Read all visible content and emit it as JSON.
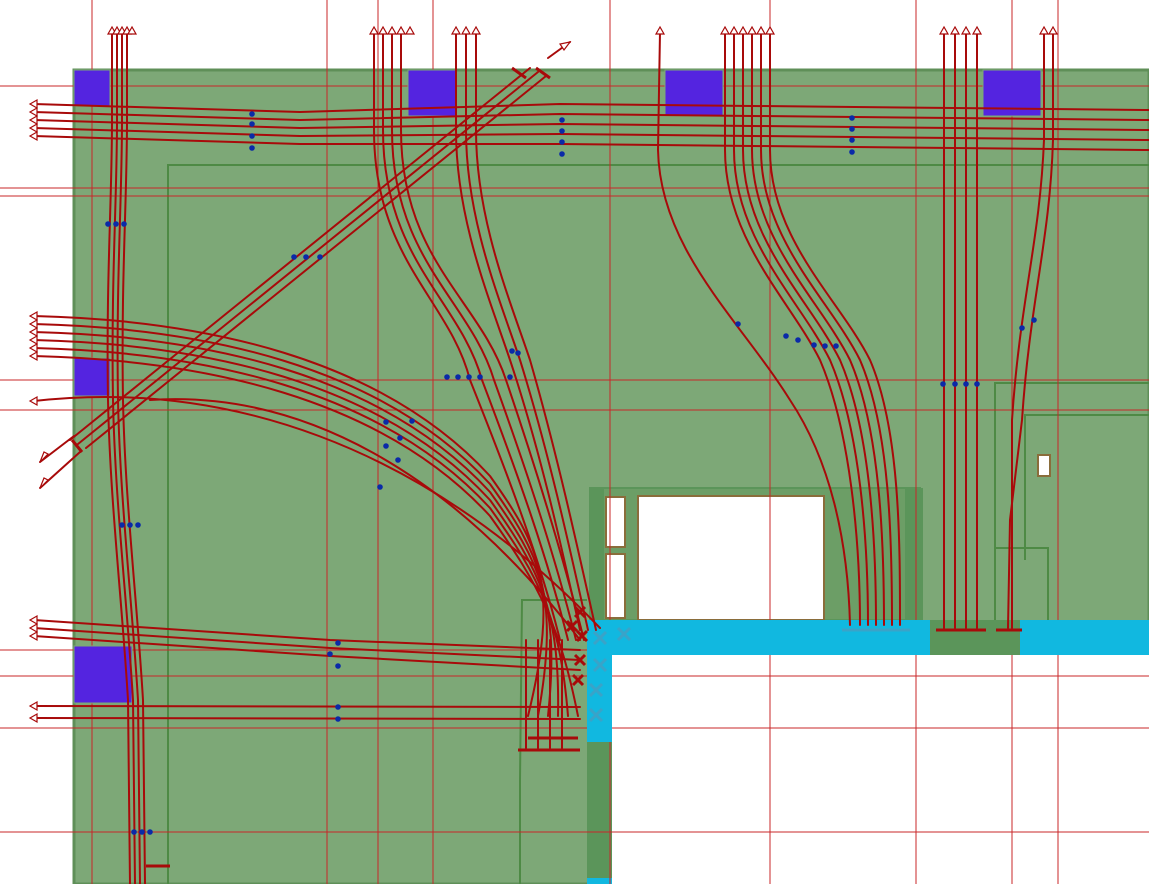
{
  "colors": {
    "background": "#ffffff",
    "floor": "#7da877",
    "floor_border": "#5f8f58",
    "inner_outline": "#4e8a45",
    "grid": "#c8272a",
    "wire": "#a80a0a",
    "junction": "#0a2aa8",
    "rack": "#5424e0",
    "opening_fill": "#ffffff",
    "opening_border": "#8a6d3b",
    "tray": "#11b8e0",
    "tray_marker": "#3aa3c8",
    "wall_band": "#5b955a",
    "arrow": "#a80a0a"
  },
  "icons": {
    "rack": "square-block",
    "junction": "dot",
    "terminal": "arrowhead-outline",
    "termination": "cross-mark"
  }
}
